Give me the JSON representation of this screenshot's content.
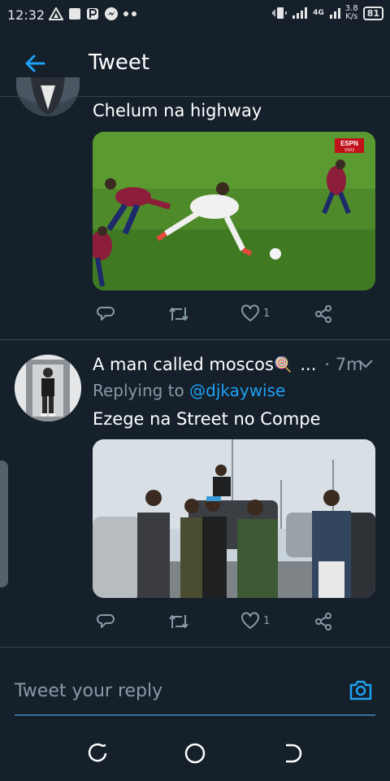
{
  "status_bar": {
    "time": "12:32",
    "network_speed_value": "3.8",
    "network_speed_unit": "K/s",
    "network_type": "4G",
    "battery": "81"
  },
  "header": {
    "title": "Tweet"
  },
  "tweets": [
    {
      "text": "Chelum na highway",
      "media_badge": "ESPN",
      "media_badge_sub": "VIVO",
      "like_count": "1"
    },
    {
      "username": "A man called moscos",
      "username_emoji": "🍭",
      "ellipsis": "...",
      "time": "· 7m",
      "replying_prefix": "Replying to",
      "replying_handle": "@djkaywise",
      "text": "Ezege na Street no Compe",
      "like_count": "1"
    }
  ],
  "reply_box": {
    "placeholder": "Tweet your reply"
  },
  "colors": {
    "background": "#15202b",
    "accent": "#1da1f2",
    "muted": "#8899a6",
    "divider": "#38444d"
  },
  "icons": [
    "back-arrow-icon",
    "chevron-down-icon",
    "reply-icon",
    "retweet-icon",
    "like-icon",
    "share-icon",
    "camera-icon",
    "recents-icon",
    "home-icon",
    "back-icon"
  ]
}
